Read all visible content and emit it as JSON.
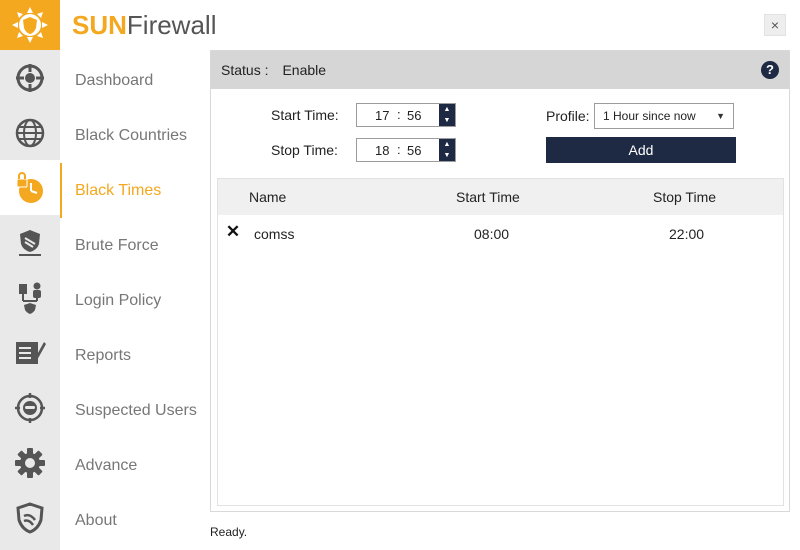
{
  "app": {
    "title_brand": "SUN",
    "title_product": "Firewall"
  },
  "window": {
    "close_glyph": "×"
  },
  "sidebar": {
    "active_index": 2,
    "items": [
      {
        "label": "Dashboard",
        "icon": "dashboard-icon"
      },
      {
        "label": "Black Countries",
        "icon": "globe-icon"
      },
      {
        "label": "Black Times",
        "icon": "clock-lock-icon"
      },
      {
        "label": "Brute Force",
        "icon": "shield-hammer-icon"
      },
      {
        "label": "Login Policy",
        "icon": "users-policy-icon"
      },
      {
        "label": "Reports",
        "icon": "reports-icon"
      },
      {
        "label": "Suspected Users",
        "icon": "suspect-target-icon"
      },
      {
        "label": "Advance",
        "icon": "gear-icon"
      },
      {
        "label": "About",
        "icon": "shield-about-icon"
      }
    ]
  },
  "status": {
    "label": "Status :",
    "value": "Enable",
    "help_glyph": "?"
  },
  "form": {
    "start_label": "Start Time:",
    "start_hour": "17",
    "start_minute": "56",
    "stop_label": "Stop Time:",
    "stop_hour": "18",
    "stop_minute": "56",
    "time_separator": ":",
    "profile_label": "Profile:",
    "profile_value": "1 Hour since now",
    "add_label": "Add"
  },
  "table": {
    "columns": [
      "Name",
      "Start Time",
      "Stop Time"
    ],
    "rows": [
      {
        "name": "comss",
        "start": "08:00",
        "stop": "22:00"
      }
    ]
  },
  "footer": {
    "status": "Ready."
  },
  "colors": {
    "accent": "#f4a81f",
    "navy": "#1e2a44",
    "rail": "#e9e9e9"
  }
}
